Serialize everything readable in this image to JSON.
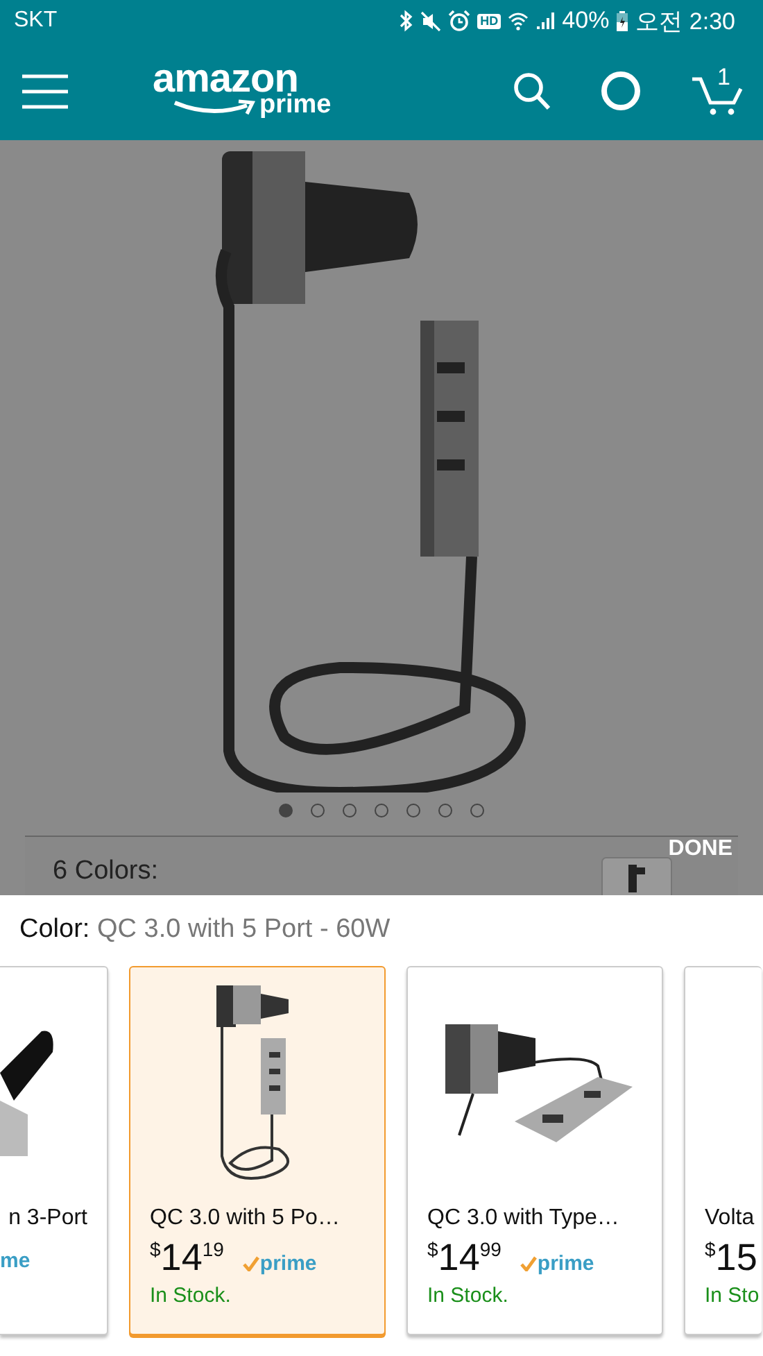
{
  "status_bar": {
    "carrier": "SKT",
    "hd_label": "HD",
    "battery": "40%",
    "time": "오전 2:30"
  },
  "header": {
    "logo_word": "amazon",
    "logo_sub": "prime",
    "cart_count": "1"
  },
  "gallery": {
    "dots": [
      {
        "selected": true
      },
      {
        "selected": false
      },
      {
        "selected": false
      },
      {
        "selected": false
      },
      {
        "selected": false
      },
      {
        "selected": false
      },
      {
        "selected": false
      }
    ],
    "done": "DONE",
    "colors_label": "6 Colors:"
  },
  "color_picker": {
    "label": "Color:",
    "value": "QC 3.0 with 5 Port - 60W",
    "options": [
      {
        "kind": "partial-left",
        "title": "n 3-Port",
        "badge": "me",
        "selected": false
      },
      {
        "kind": "full",
        "title": "QC 3.0 with 5 Po…",
        "currency": "$",
        "price_whole": "14",
        "price_fraction": "19",
        "badge": "prime",
        "stock": "In Stock.",
        "selected": true
      },
      {
        "kind": "full",
        "title": "QC 3.0 with Type…",
        "currency": "$",
        "price_whole": "14",
        "price_fraction": "99",
        "badge": "prime",
        "stock": "In Stock.",
        "selected": false
      },
      {
        "kind": "partial-right",
        "title": "Volta",
        "currency": "$",
        "price_whole": "15",
        "stock": "In Sto",
        "selected": false
      }
    ]
  }
}
